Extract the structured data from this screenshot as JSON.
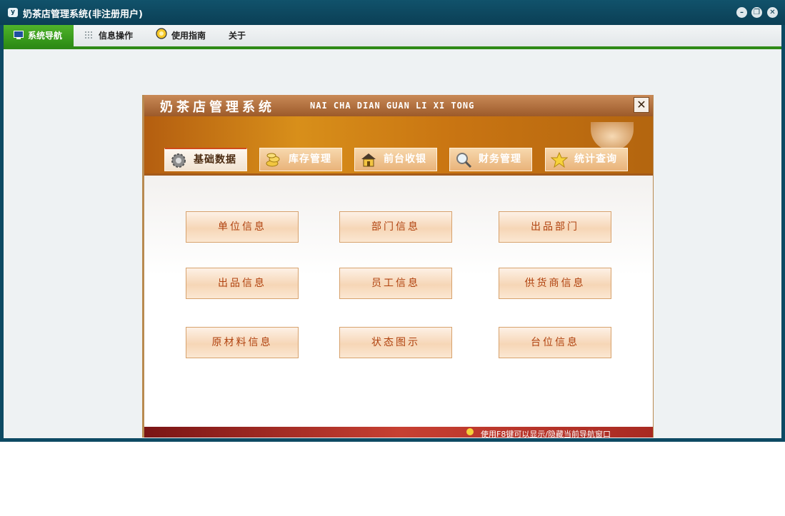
{
  "window": {
    "title": "奶茶店管理系统(非注册用户)",
    "app_icon": "y",
    "controls": [
      "minimize-icon",
      "restore-icon",
      "close-icon"
    ]
  },
  "menu": {
    "items": [
      {
        "label": "系统导航",
        "icon": "monitor-icon"
      },
      {
        "label": "信息操作",
        "icon": "grid-icon"
      },
      {
        "label": "使用指南",
        "icon": "lightbulb-icon"
      },
      {
        "label": "关于",
        "icon": ""
      }
    ]
  },
  "panel": {
    "title": "奶茶店管理系统",
    "subtitle": "NAI CHA DIAN GUAN LI XI TONG",
    "close_label": "✕",
    "tabs": [
      {
        "label": "基础数据",
        "icon": "gear-icon"
      },
      {
        "label": "库存管理",
        "icon": "coins-icon"
      },
      {
        "label": "前台收银",
        "icon": "house-icon"
      },
      {
        "label": "财务管理",
        "icon": "magnifier-icon"
      },
      {
        "label": "统计查询",
        "icon": "star-icon"
      }
    ],
    "buttons": [
      "单位信息",
      "部门信息",
      "出品部门",
      "出品信息",
      "员工信息",
      "供货商信息",
      "原材料信息",
      "状态图示",
      "台位信息"
    ],
    "status_text": "使用F8键可以显示/隐藏当前导航窗口"
  },
  "colors": {
    "frame": "#0d4a63",
    "accent_green": "#2e8a17",
    "panel_brown": "#b88a50",
    "button_text": "#b0420f",
    "status_red": "#c74032"
  }
}
